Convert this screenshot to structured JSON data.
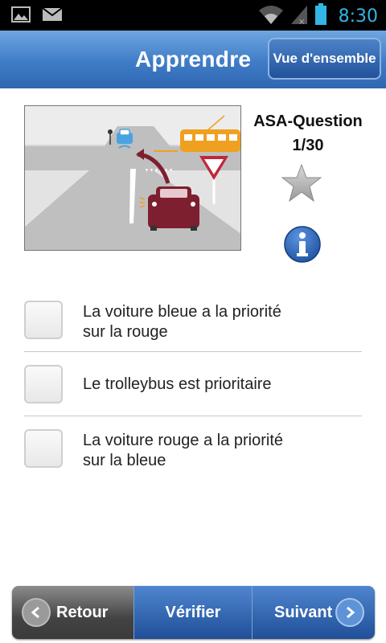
{
  "status_bar": {
    "time": "8:30",
    "icons": [
      "image-icon",
      "mail-icon",
      "wifi-icon",
      "signal-icon",
      "battery-icon"
    ]
  },
  "header": {
    "title": "Apprendre",
    "overview_label": "Vue d'ensemble"
  },
  "question": {
    "category": "ASA-Question",
    "counter": "1/30",
    "favorite_icon": "star-icon",
    "info_icon": "info-icon"
  },
  "answers": [
    {
      "line1": "La voiture bleue a la priorité",
      "line2": "sur la rouge",
      "checked": false
    },
    {
      "line1": "Le trolleybus est prioritaire",
      "line2": "",
      "checked": false
    },
    {
      "line1": "La voiture rouge a la priorité",
      "line2": "sur la bleue",
      "checked": false
    }
  ],
  "bottom_nav": {
    "back_label": "Retour",
    "verify_label": "Vérifier",
    "next_label": "Suivant"
  },
  "colors": {
    "accent": "#3f7cc7",
    "status_icon": "#33b5e5",
    "red_car": "#7d1f2e",
    "trolleybus": "#f0a020",
    "blue_car": "#4aa3e0"
  }
}
